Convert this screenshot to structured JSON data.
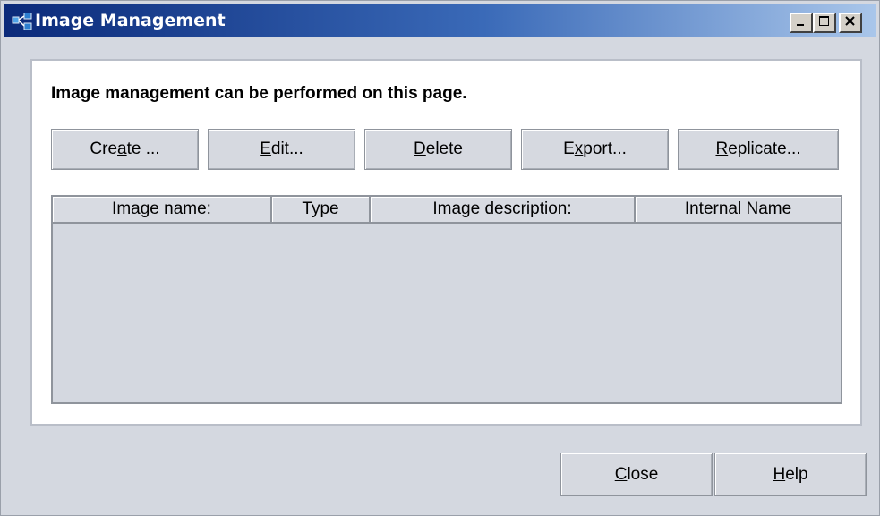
{
  "window": {
    "title": "Image Management",
    "controls": {
      "minimize": "_",
      "maximize": "□",
      "close": "×"
    }
  },
  "panel": {
    "description": "Image management can be performed on this page."
  },
  "toolbar": {
    "buttons": [
      {
        "pre": "Cre",
        "ul": "a",
        "post": "te ..."
      },
      {
        "pre": "",
        "ul": "E",
        "post": "dit..."
      },
      {
        "pre": "",
        "ul": "D",
        "post": "elete"
      },
      {
        "pre": "E",
        "ul": "x",
        "post": "port..."
      },
      {
        "pre": "",
        "ul": "R",
        "post": "eplicate..."
      }
    ]
  },
  "table": {
    "columns": [
      "Image name:",
      "Type",
      "Image description:",
      "Internal Name"
    ],
    "rows": []
  },
  "footer": {
    "close": {
      "pre": "",
      "ul": "C",
      "post": "lose"
    },
    "help": {
      "pre": "",
      "ul": "H",
      "post": "elp"
    }
  },
  "colors": {
    "title_gradient_start": "#0b2a7a",
    "title_gradient_end": "#a9c6ea",
    "window_bg": "#d4d8e0",
    "panel_bg": "#ffffff"
  }
}
